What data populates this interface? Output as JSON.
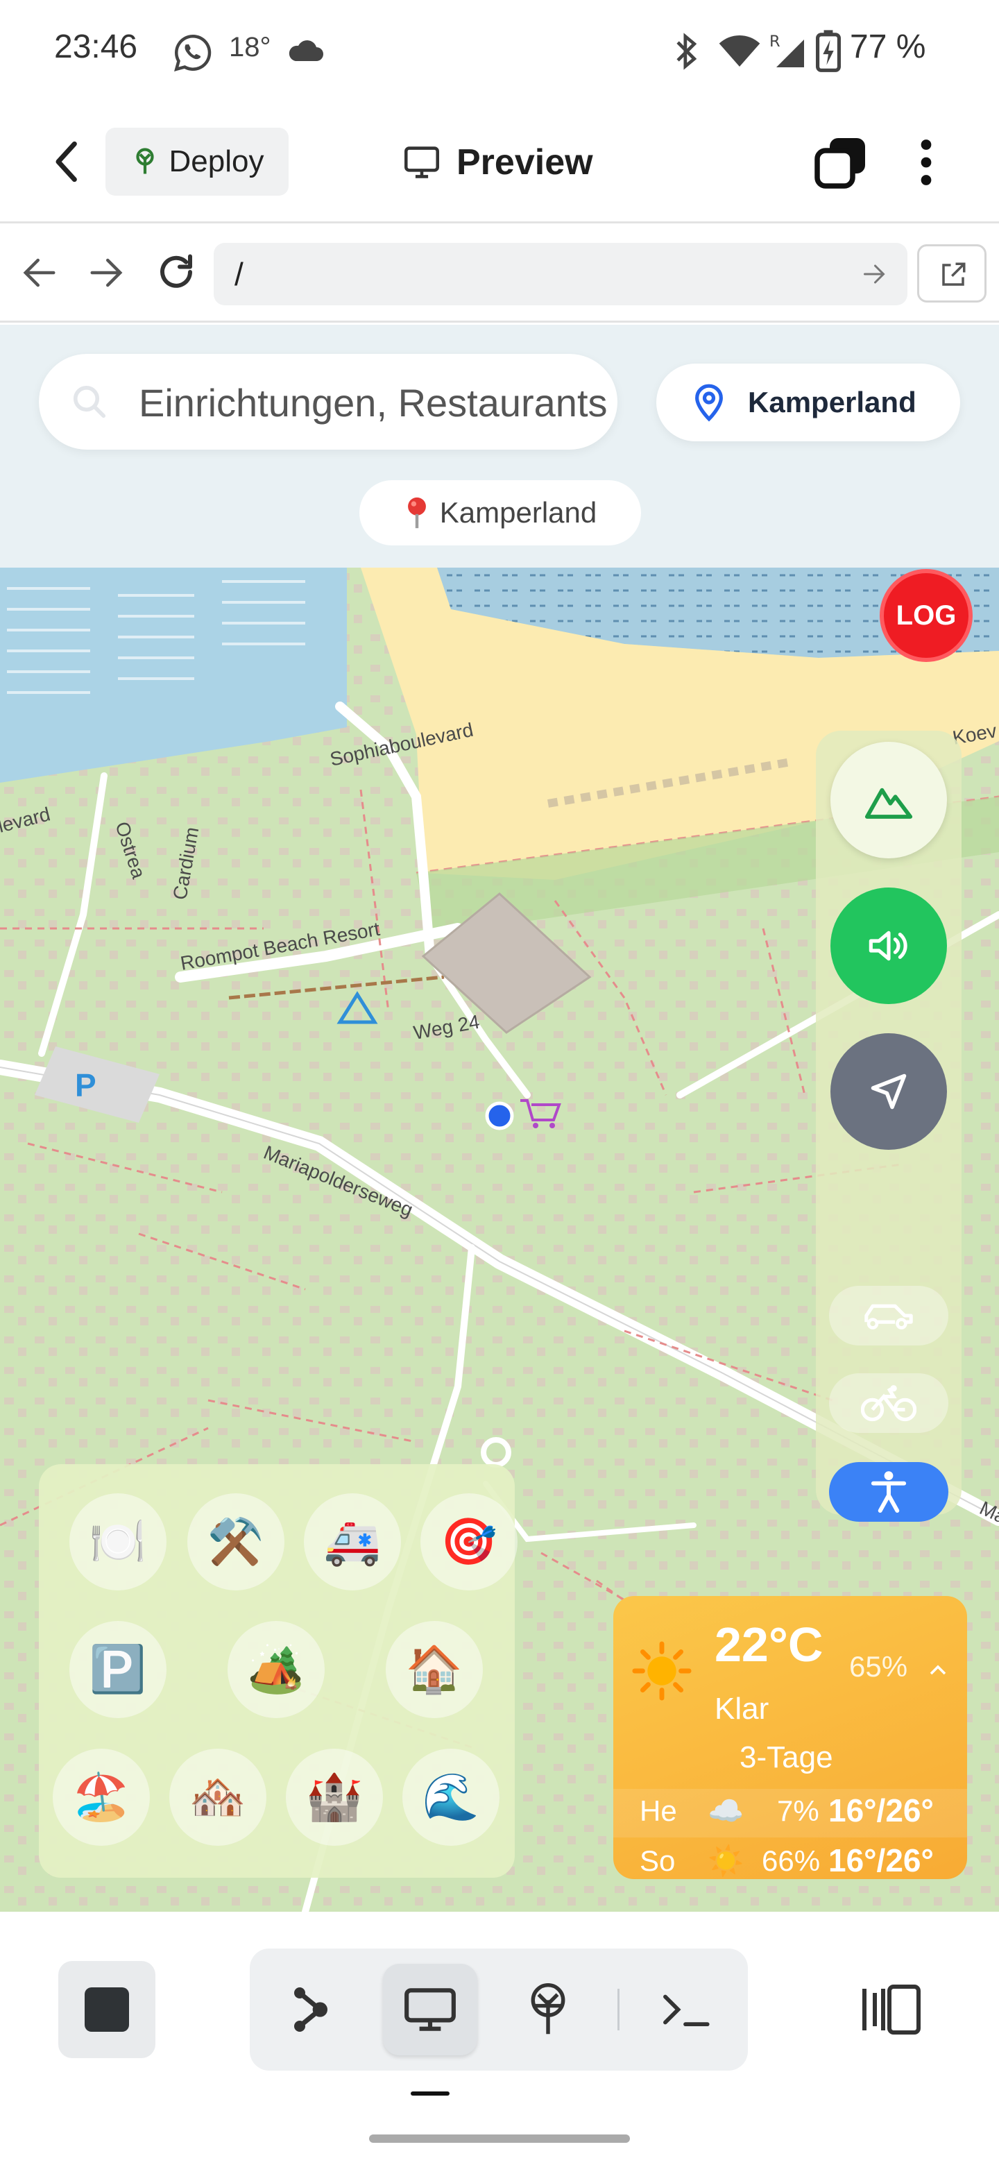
{
  "status_bar": {
    "time": "23:46",
    "temperature": "18°",
    "battery": "77 %",
    "icons": [
      "whatsapp-icon",
      "cloud-icon",
      "bluetooth-icon",
      "wifi-icon",
      "signal-icon",
      "battery-icon"
    ]
  },
  "app_header": {
    "deploy_label": "Deploy",
    "preview_label": "Preview"
  },
  "browser": {
    "url": "/"
  },
  "map_app": {
    "search_placeholder": "Einrichtungen, Restaurants",
    "location_button": "Kamperland",
    "location_pill": "Kamperland",
    "log_button": "LOG",
    "poi_icons": [
      "🍽️",
      "⚒️",
      "🚑",
      "🎯",
      "🅿️",
      "🏕️",
      "🏠",
      "🏖️",
      "🏘️",
      "🏰",
      "🌊"
    ],
    "map_labels": {
      "road1": "Sophiaboulevard",
      "road2": "Roompot Beach Resort",
      "road3": "Weg 24",
      "road4": "Mariapolderseweg",
      "road5": "Ostrea",
      "road6": "Cardium",
      "road7": "levard",
      "road8": "Koev",
      "road9": "Ma",
      "parking": "P"
    }
  },
  "weather": {
    "temperature": "22°C",
    "humidity": "65%",
    "condition": "Klar",
    "forecast_title": "3-Tage",
    "forecast": [
      {
        "day": "He",
        "icon": "☁️",
        "precip": "7%",
        "range": "16°/26°"
      },
      {
        "day": "So",
        "icon": "☀️",
        "precip": "66%",
        "range": "16°/26°"
      }
    ]
  },
  "colors": {
    "accent_green": "#22c55e",
    "accent_blue": "#3b82f6",
    "log_red": "#ef1c23",
    "weather_orange": "#f8ab34"
  }
}
